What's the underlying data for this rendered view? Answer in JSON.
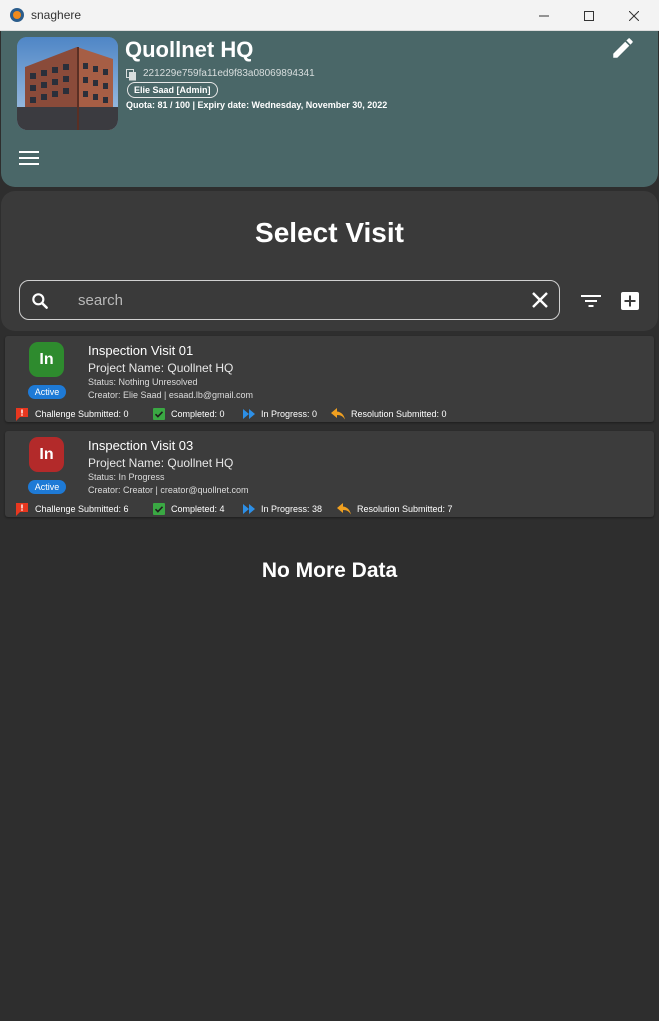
{
  "window": {
    "app_title": "snaghere",
    "min_icon": "minimize-icon",
    "max_icon": "maximize-icon",
    "close_icon": "close-icon"
  },
  "header": {
    "project_title": "Quollnet HQ",
    "project_id": "221229e759fa11ed9f83a08069894341",
    "user_chip": "Elie Saad [Admin]",
    "quota": "Quota: 81 / 100 | Expiry date: Wednesday, November 30, 2022",
    "background_color": "#4a6768"
  },
  "panel": {
    "title": "Select Visit",
    "search_placeholder": "search",
    "search_value": ""
  },
  "visits": [
    {
      "avatar_text": "In",
      "avatar_color": "#2e8b2e",
      "badge": "Active",
      "name": "Inspection Visit 01",
      "project": "Project Name: Quollnet HQ",
      "status": "Status: Nothing Unresolved",
      "creator": "Creator: Elie Saad | esaad.lb@gmail.com",
      "stats": {
        "challenge": "Challenge Submitted: 0",
        "completed": "Completed: 0",
        "in_progress": "In Progress: 0",
        "resolution": "Resolution Submitted: 0"
      }
    },
    {
      "avatar_text": "In",
      "avatar_color": "#b32a2a",
      "badge": "Active",
      "name": "Inspection Visit 03",
      "project": "Project Name: Quollnet HQ",
      "status": "Status: In Progress",
      "creator": "Creator: Creator | creator@quollnet.com",
      "stats": {
        "challenge": "Challenge Submitted: 6",
        "completed": "Completed: 4",
        "in_progress": "In Progress: 38",
        "resolution": "Resolution Submitted: 7"
      }
    }
  ],
  "footer_text": "No More Data",
  "colors": {
    "challenge": "#e8371f",
    "completed": "#3aa843",
    "in_progress": "#2d8fe6",
    "resolution": "#f0a020",
    "badge": "#1e7ad6"
  }
}
